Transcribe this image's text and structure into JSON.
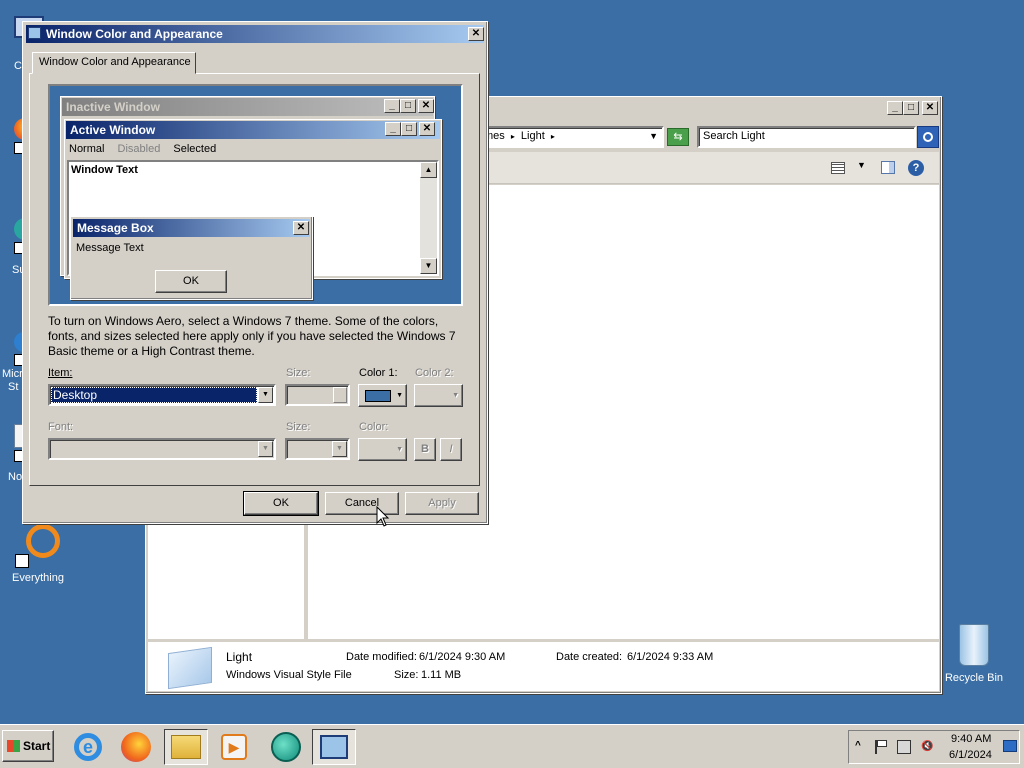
{
  "desktop": {
    "left_edge_labels": [
      "C",
      "Su",
      "Micr",
      "St",
      "No"
    ],
    "everything_label": "Everything",
    "recycle_bin_label": "Recycle Bin"
  },
  "explorer": {
    "breadcrumb": "mes",
    "breadcrumb_sep": "▸",
    "breadcrumb_current": "Light",
    "search_placeholder": "Search Light",
    "file": {
      "name": "Light",
      "type": "Windows Visual Style File",
      "date_modified_label": "Date modified:",
      "date_modified": "6/1/2024 9:30 AM",
      "date_created_label": "Date created:",
      "date_created": "6/1/2024 9:33 AM",
      "size_label": "Size:",
      "size": "1.11 MB"
    }
  },
  "dialog": {
    "title": "Window Color and Appearance",
    "tab": "Window Color and Appearance",
    "preview": {
      "inactive_title": "Inactive Window",
      "active_title": "Active Window",
      "menu_normal": "Normal",
      "menu_disabled": "Disabled",
      "menu_selected": "Selected",
      "window_text": "Window Text",
      "msgbox_title": "Message Box",
      "msgbox_text": "Message Text",
      "msgbox_ok": "OK"
    },
    "info_text": "To turn on Windows Aero, select a Windows 7 theme.  Some of the colors, fonts, and sizes selected here apply only if you have selected the Windows 7 Basic theme or a High Contrast theme.",
    "item_label": "Item:",
    "item_value": "Desktop",
    "size_label": "Size:",
    "color1_label": "Color 1:",
    "color2_label": "Color 2:",
    "font_label": "Font:",
    "font_size_label": "Size:",
    "font_color_label": "Color:",
    "bold_label": "B",
    "italic_label": "I",
    "ok": "OK",
    "cancel": "Cancel",
    "apply": "Apply",
    "color1_swatch": "#3a6ea5"
  },
  "taskbar": {
    "start": "Start",
    "clock_time": "9:40 AM",
    "clock_date": "6/1/2024"
  }
}
